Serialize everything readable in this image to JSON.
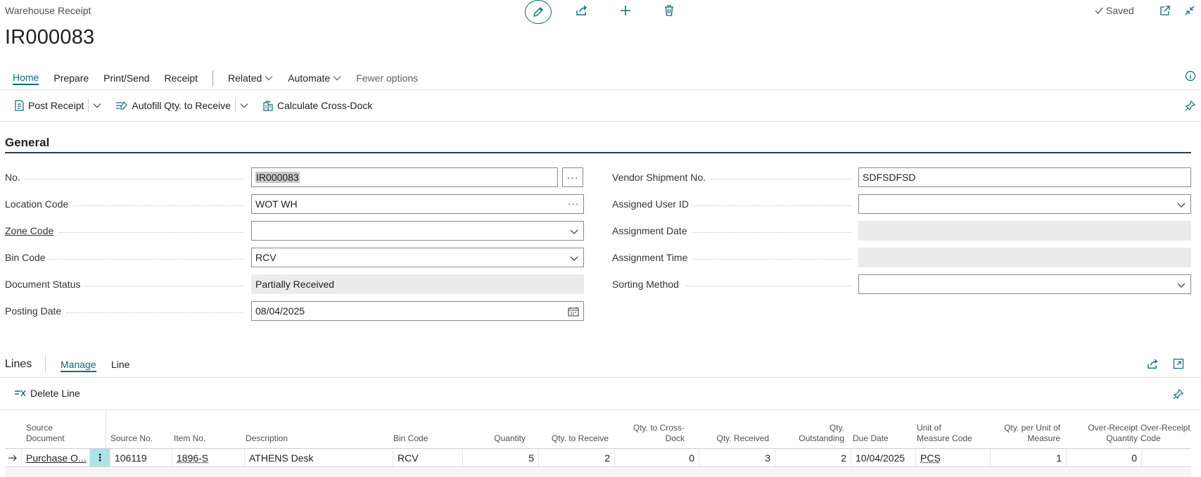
{
  "header": {
    "caption": "Warehouse Receipt",
    "title": "IR000083",
    "saved_label": "Saved"
  },
  "tabs": [
    {
      "label": "Home"
    },
    {
      "label": "Prepare"
    },
    {
      "label": "Print/Send"
    },
    {
      "label": "Receipt"
    },
    {
      "label": "Related"
    },
    {
      "label": "Automate"
    },
    {
      "label": "Fewer options"
    }
  ],
  "actions": {
    "post_receipt": "Post Receipt",
    "autofill": "Autofill Qty. to Receive",
    "cross_dock": "Calculate Cross-Dock"
  },
  "general": {
    "title": "General",
    "no_label": "No.",
    "no_value": "IR000083",
    "location_label": "Location Code",
    "location_value": "WOT WH",
    "zone_label": "Zone Code",
    "zone_value": "",
    "bin_label": "Bin Code",
    "bin_value": "RCV",
    "status_label": "Document Status",
    "status_value": "Partially Received",
    "posting_label": "Posting Date",
    "posting_value": "08/04/2025",
    "vendor_label": "Vendor Shipment No.",
    "vendor_value": "SDFSDFSD",
    "assigned_user_label": "Assigned User ID",
    "assigned_user_value": "",
    "assignment_date_label": "Assignment Date",
    "assignment_time_label": "Assignment Time",
    "sorting_label": "Sorting Method",
    "sorting_value": "",
    "assist_dots": "···"
  },
  "lines": {
    "title": "Lines",
    "tab_manage": "Manage",
    "tab_line": "Line",
    "delete_line": "Delete Line",
    "columns": {
      "source_document": "Source\nDocument",
      "source_no": "Source No.",
      "item_no": "Item No.",
      "description": "Description",
      "bin_code": "Bin Code",
      "quantity": "Quantity",
      "qty_to_receive": "Qty. to Receive",
      "qty_cross_dock": "Qty. to Cross-\nDock",
      "qty_received": "Qty. Received",
      "qty_outstanding": "Qty.\nOutstanding",
      "due_date": "Due Date",
      "uom": "Unit of\nMeasure Code",
      "qty_per_uom": "Qty. per Unit of\nMeasure",
      "over_receipt_qty": "Over-Receipt\nQuantity",
      "over_receipt_code": "Over-Receipt\nCode"
    },
    "rows": [
      {
        "source_document": "Purchase O...",
        "source_no": "106119",
        "item_no": "1896-S",
        "description": "ATHENS Desk",
        "bin_code": "RCV",
        "quantity": "5",
        "qty_to_receive": "2",
        "qty_cross_dock": "0",
        "qty_received": "3",
        "qty_outstanding": "2",
        "due_date": "10/04/2025",
        "uom": "PCS",
        "qty_per_uom": "1",
        "over_receipt_qty": "0",
        "over_receipt_code": ""
      }
    ]
  },
  "colors": {
    "accent": "#0b6a75",
    "row_menu_bg": "#aee3ea",
    "header_rule": "#2e3d4a"
  }
}
